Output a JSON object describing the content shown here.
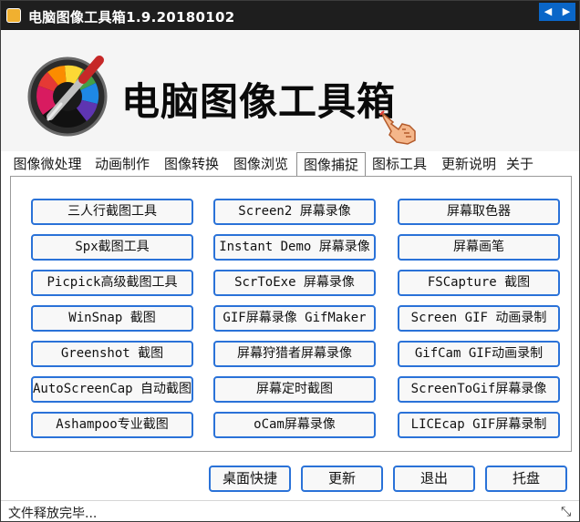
{
  "window": {
    "title": "电脑图像工具箱1.9.20180102",
    "minimize_glyph": "–",
    "close_glyph": "✕"
  },
  "header": {
    "banner": "电脑图像工具箱",
    "logo_icon": "color-picker-eyedropper-icon",
    "pointer_icon": "pointing-hand-icon"
  },
  "tabs": {
    "items": [
      {
        "label": "图像微处理"
      },
      {
        "label": "动画制作"
      },
      {
        "label": "图像转换"
      },
      {
        "label": "图像浏览"
      },
      {
        "label": "图像捕捉",
        "active": true
      },
      {
        "label": "图标工具"
      },
      {
        "label": "更新说明"
      },
      {
        "label": "关于"
      }
    ],
    "scroll_left": "◀",
    "scroll_right": "▶"
  },
  "tools": {
    "col1": [
      "三人行截图工具",
      "Spx截图工具",
      "Picpick高级截图工具",
      "WinSnap 截图",
      "Greenshot 截图",
      "AutoScreenCap 自动截图",
      "Ashampoo专业截图"
    ],
    "col2": [
      "Screen2 屏幕录像",
      "Instant Demo 屏幕录像",
      "ScrToExe 屏幕录像",
      "GIF屏幕录像 GifMaker",
      "屏幕狩猎者屏幕录像",
      "屏幕定时截图",
      "oCam屏幕录像"
    ],
    "col3": [
      "屏幕取色器",
      "屏幕画笔",
      "FSCapture 截图",
      "Screen GIF 动画录制",
      "GifCam GIF动画录制",
      "ScreenToGif屏幕录像",
      "LICEcap GIF屏幕录制"
    ]
  },
  "actions": {
    "desktop_shortcut": "桌面快捷",
    "update": "更新",
    "exit": "退出",
    "tray": "托盘"
  },
  "status": {
    "text": "文件释放完毕...",
    "grip": "⤡"
  },
  "colors": {
    "titlebar": "#1e1e1e",
    "button_border": "#2a72d8",
    "tab_scroll": "#0a66c8"
  }
}
